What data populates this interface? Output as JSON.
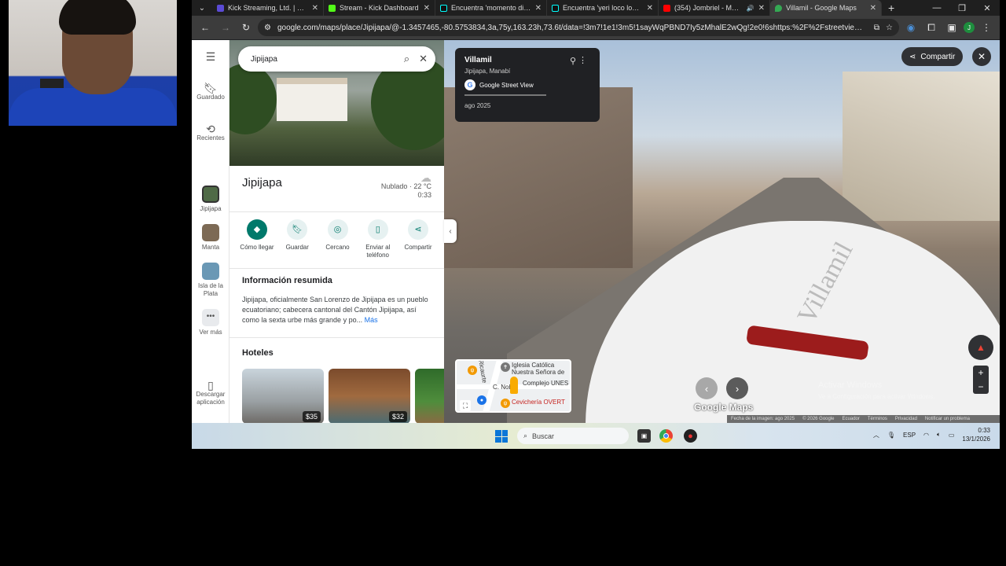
{
  "browser": {
    "tabs": [
      {
        "title": "Kick Streaming, Ltd. | Confi",
        "color": "#5b4bd5",
        "active": false
      },
      {
        "title": "Stream - Kick Dashboard",
        "color": "#53fc18",
        "active": false
      },
      {
        "title": "Encuentra 'momento dive",
        "color": "#111111",
        "active": false
      },
      {
        "title": "Encuentra 'yeri loco loco n",
        "color": "#111111",
        "active": false
      },
      {
        "title": "(354) Jombriel - Masal",
        "color": "#ff0000",
        "active": false
      },
      {
        "title": "Villamil - Google Maps",
        "color": "#34a853",
        "active": true
      }
    ],
    "url": "google.com/maps/place/Jipijapa/@-1.3457465,-80.5753834,3a,75y,163.23h,73.6t/data=!3m7!1e1!3m5!1sayWqPBND7Iy5zMhalE2wQg!2e0!6shttps:%2F%2Fstreetviewpixels-pa...",
    "profile_initial": "J"
  },
  "maps": {
    "search_value": "Jipijapa",
    "rail": {
      "saved": "Guardado",
      "recent": "Recientes",
      "jipijapa": "Jipijapa",
      "manta": "Manta",
      "isla": "Isla de la Plata",
      "more": "Ver más",
      "download": "Descargar aplicación"
    },
    "place_title": "Jipijapa",
    "weather": {
      "condition": "Nublado · 22 °C",
      "time": "0:33"
    },
    "actions": {
      "directions": "Cómo llegar",
      "save": "Guardar",
      "nearby": "Cercano",
      "send_phone": "Enviar al teléfono",
      "share": "Compartir"
    },
    "summary": {
      "heading": "Información resumida",
      "text": "Jipijapa, oficialmente San Lorenzo de Jipijapa es un pueblo ecuatoriano; cabecera cantonal del Cantón Jipijapa, así como la sexta urbe más grande y po...",
      "more": "Más"
    },
    "hotels": {
      "heading": "Hoteles",
      "items": [
        {
          "price": "$35"
        },
        {
          "price": "$32"
        },
        {
          "price": ""
        }
      ]
    }
  },
  "streetview": {
    "card": {
      "name": "Villamil",
      "location": "Jipijapa, Manabí",
      "source": "Google Street View",
      "date": "ago 2025"
    },
    "share_label": "Compartir",
    "car_text": "Villamil",
    "minimap": {
      "labels": [
        "Iglesia Católica",
        "Nuestra Señora de",
        "Complejo UNES",
        "Cevichería OVERT",
        "C. Nobo",
        "Ricaurte"
      ]
    },
    "logo": "Google Maps",
    "watermark": {
      "line1": "Activar Windows",
      "line2": "Ve a Configuración para activar Windows."
    },
    "attribution": [
      "Fecha de la imagen: ago 2025",
      "© 2026 Google",
      "Ecuador",
      "Términos",
      "Privacidad",
      "Notificar un problema"
    ]
  },
  "taskbar": {
    "search_placeholder": "Buscar",
    "lang": "ESP",
    "time": "0:33",
    "date": "13/1/2026"
  }
}
